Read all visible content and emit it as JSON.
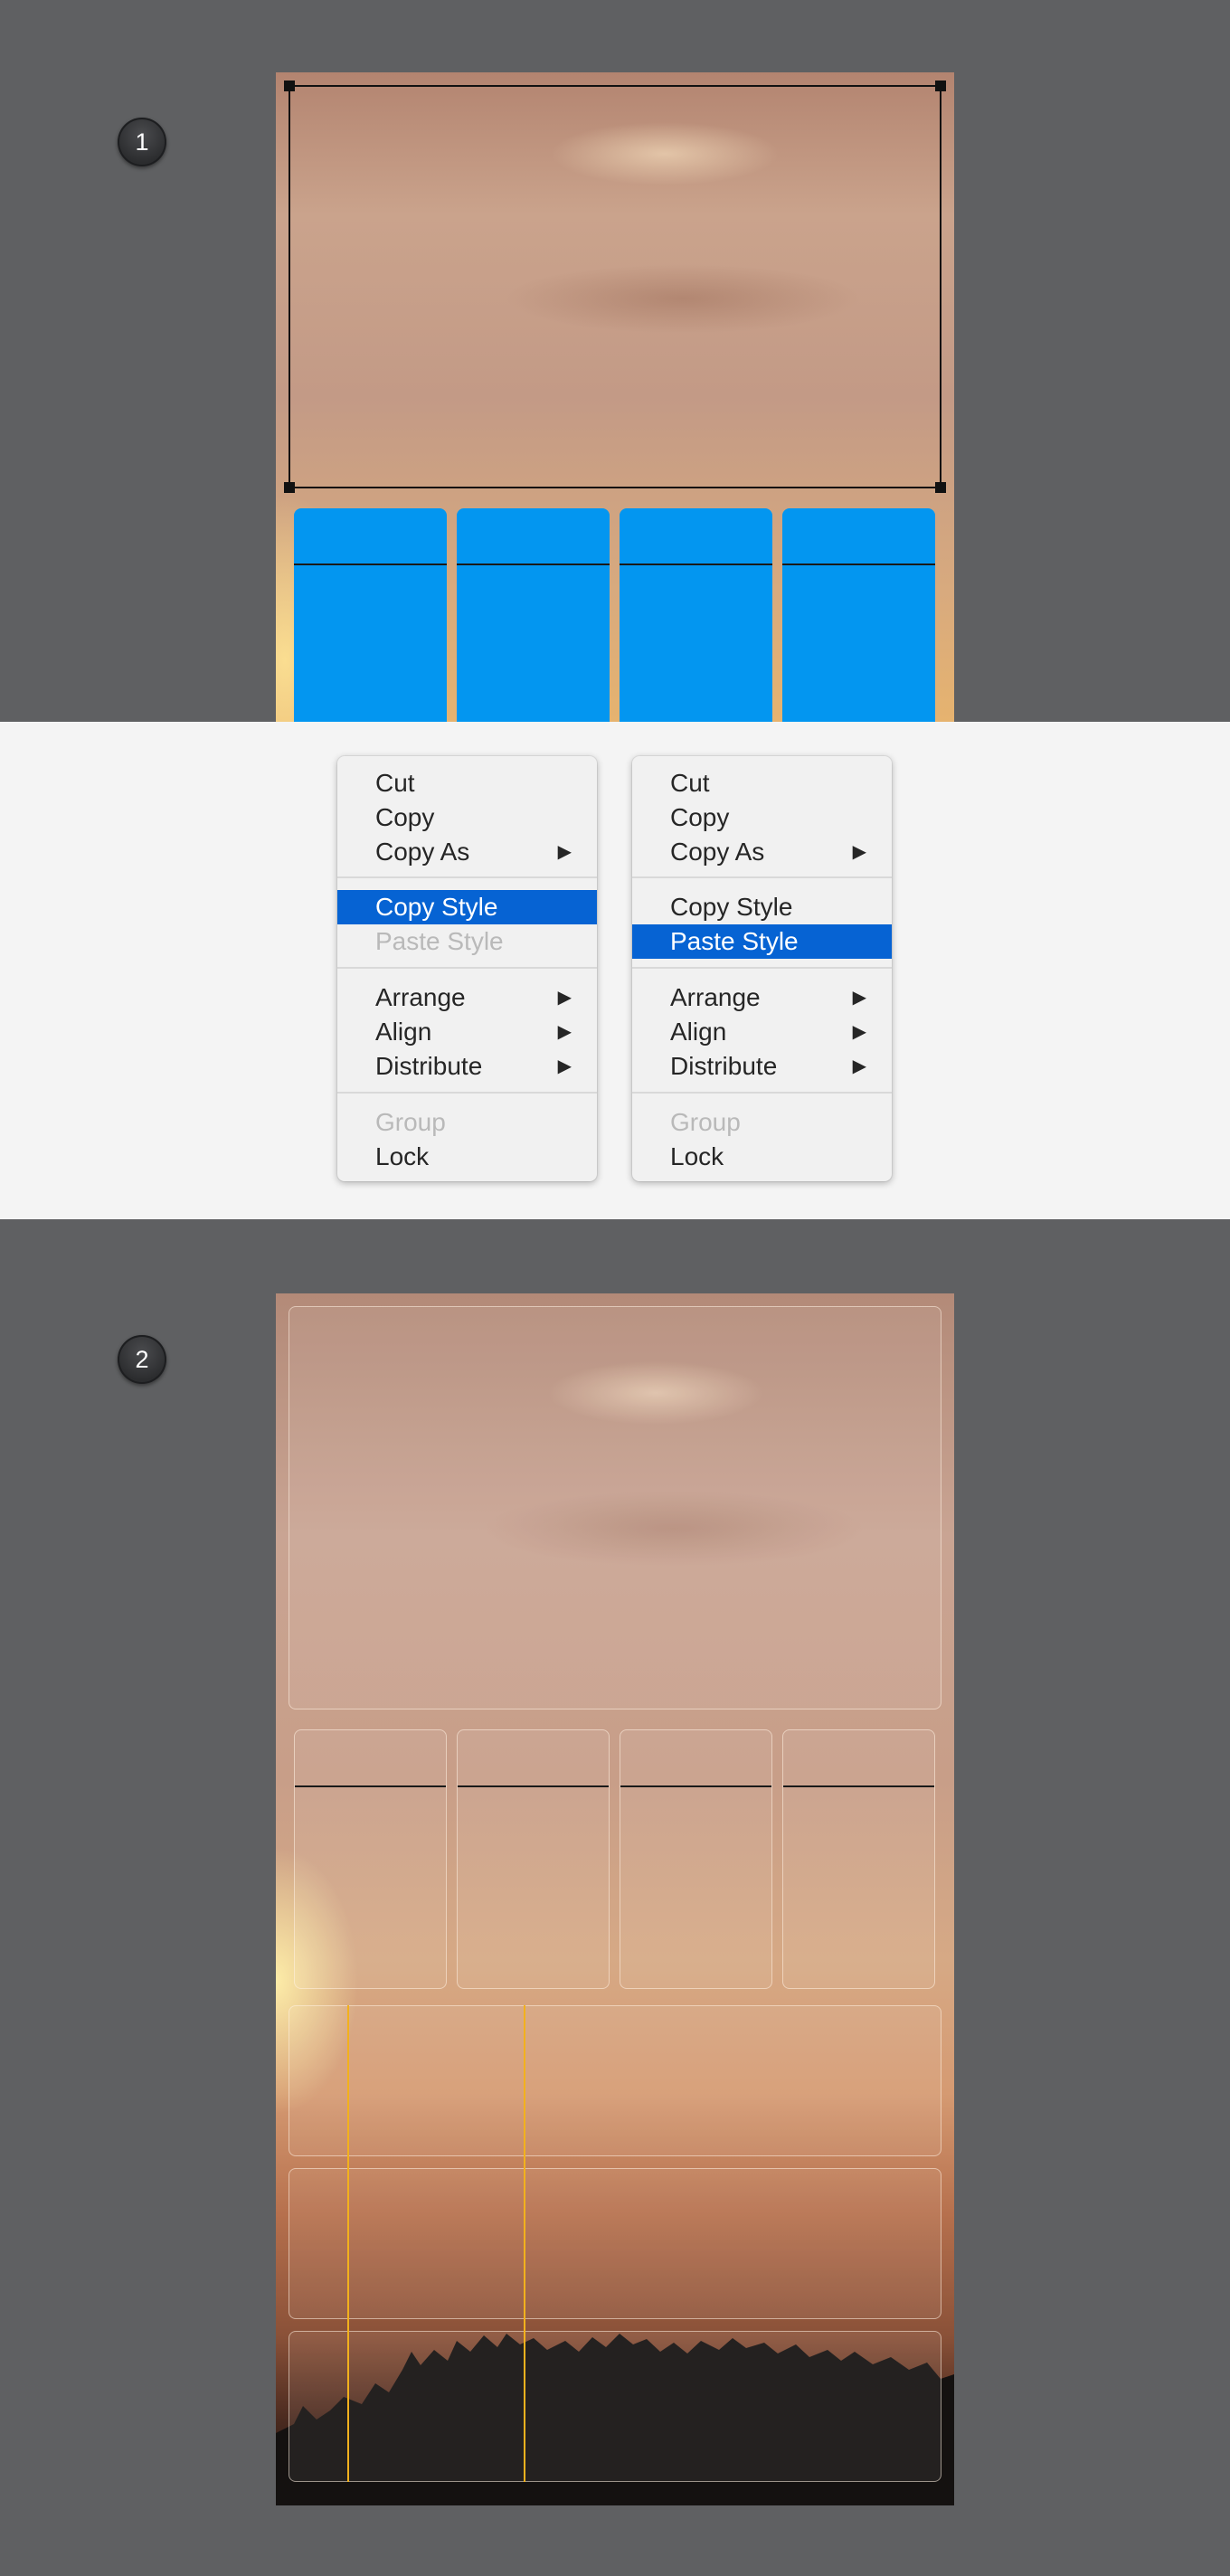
{
  "step1": {
    "badge": "1"
  },
  "step2": {
    "badge": "2"
  },
  "menus": {
    "left": {
      "items": [
        {
          "label": "Cut"
        },
        {
          "label": "Copy"
        },
        {
          "label": "Copy As",
          "submenu": true
        },
        {
          "label": "Copy Style",
          "highlighted": true
        },
        {
          "label": "Paste Style",
          "disabled": true
        },
        {
          "label": "Arrange",
          "submenu": true
        },
        {
          "label": "Align",
          "submenu": true
        },
        {
          "label": "Distribute",
          "submenu": true
        },
        {
          "label": "Group",
          "disabled": true
        },
        {
          "label": "Lock"
        }
      ]
    },
    "right": {
      "items": [
        {
          "label": "Cut"
        },
        {
          "label": "Copy"
        },
        {
          "label": "Copy As",
          "submenu": true
        },
        {
          "label": "Copy Style"
        },
        {
          "label": "Paste Style",
          "highlighted": true
        },
        {
          "label": "Arrange",
          "submenu": true
        },
        {
          "label": "Align",
          "submenu": true
        },
        {
          "label": "Distribute",
          "submenu": true
        },
        {
          "label": "Group",
          "disabled": true
        },
        {
          "label": "Lock"
        }
      ]
    },
    "submenu_arrow_icon": "triangle-right-icon"
  },
  "colors": {
    "tile_blue": "#0396f0",
    "menu_highlight": "#0663d3",
    "guide_yellow": "#f2b11d",
    "canvas_gray": "#5f6062"
  }
}
